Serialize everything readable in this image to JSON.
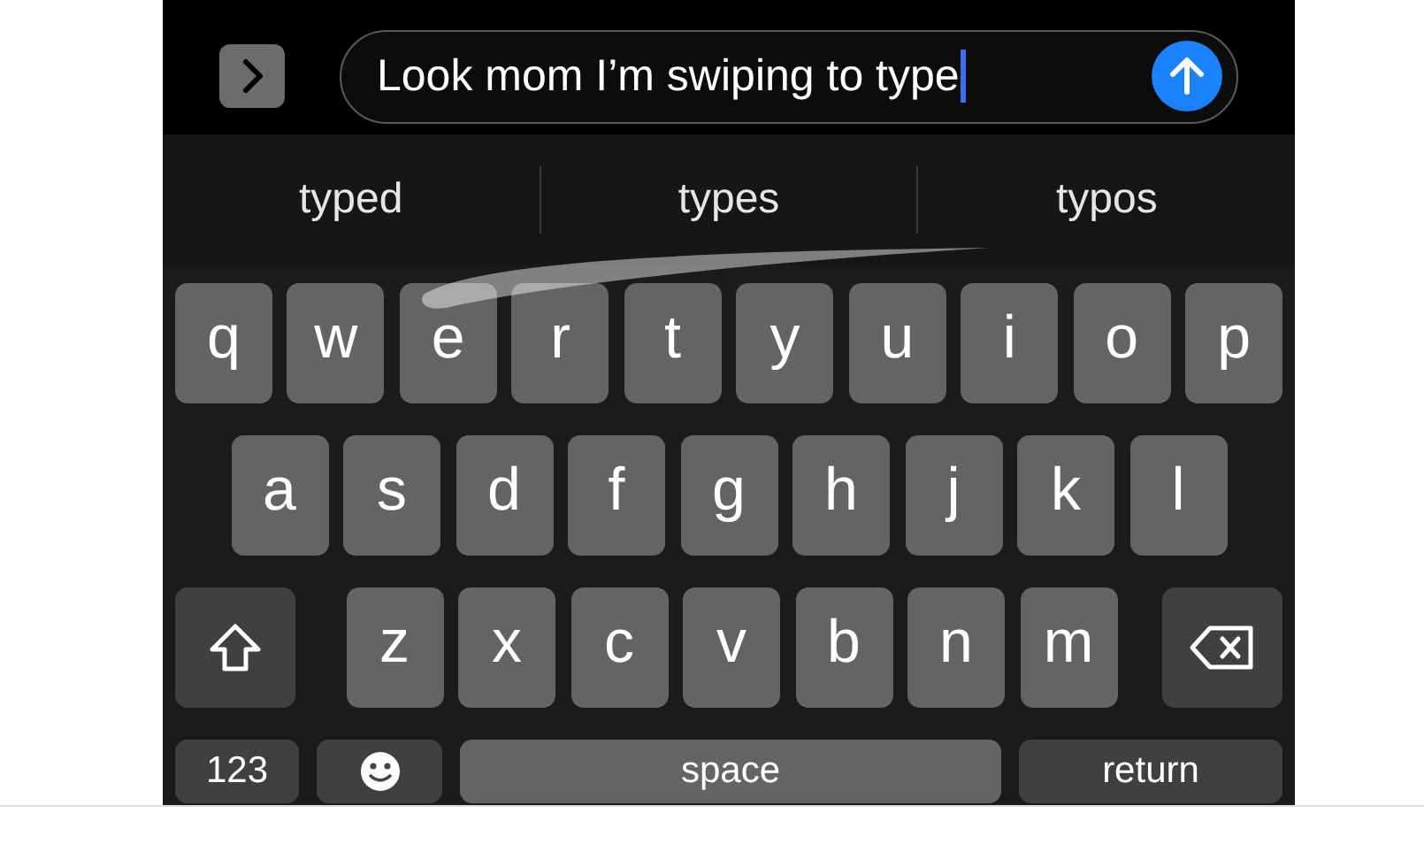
{
  "compose": {
    "message": "Look mom I’m swiping to type",
    "cursor": true
  },
  "suggestions": [
    {
      "label": "typed"
    },
    {
      "label": "types"
    },
    {
      "label": "typos"
    }
  ],
  "keyboard": {
    "swipe_trail": true,
    "rows": [
      [
        {
          "kind": "letter",
          "label": "q"
        },
        {
          "kind": "letter",
          "label": "w"
        },
        {
          "kind": "letter",
          "label": "e"
        },
        {
          "kind": "letter",
          "label": "r"
        },
        {
          "kind": "letter",
          "label": "t"
        },
        {
          "kind": "letter",
          "label": "y"
        },
        {
          "kind": "letter",
          "label": "u"
        },
        {
          "kind": "letter",
          "label": "i"
        },
        {
          "kind": "letter",
          "label": "o"
        },
        {
          "kind": "letter",
          "label": "p"
        }
      ],
      [
        {
          "kind": "letter",
          "label": "a"
        },
        {
          "kind": "letter",
          "label": "s"
        },
        {
          "kind": "letter",
          "label": "d"
        },
        {
          "kind": "letter",
          "label": "f"
        },
        {
          "kind": "letter",
          "label": "g"
        },
        {
          "kind": "letter",
          "label": "h"
        },
        {
          "kind": "letter",
          "label": "j"
        },
        {
          "kind": "letter",
          "label": "k"
        },
        {
          "kind": "letter",
          "label": "l"
        }
      ],
      [
        {
          "kind": "shift"
        },
        {
          "kind": "letter",
          "label": "z"
        },
        {
          "kind": "letter",
          "label": "x"
        },
        {
          "kind": "letter",
          "label": "c"
        },
        {
          "kind": "letter",
          "label": "v"
        },
        {
          "kind": "letter",
          "label": "b"
        },
        {
          "kind": "letter",
          "label": "n"
        },
        {
          "kind": "letter",
          "label": "m"
        },
        {
          "kind": "delete"
        }
      ]
    ],
    "bottom_bar": {
      "numbers_key": "123",
      "space_key": "space",
      "return_key": "return"
    }
  }
}
